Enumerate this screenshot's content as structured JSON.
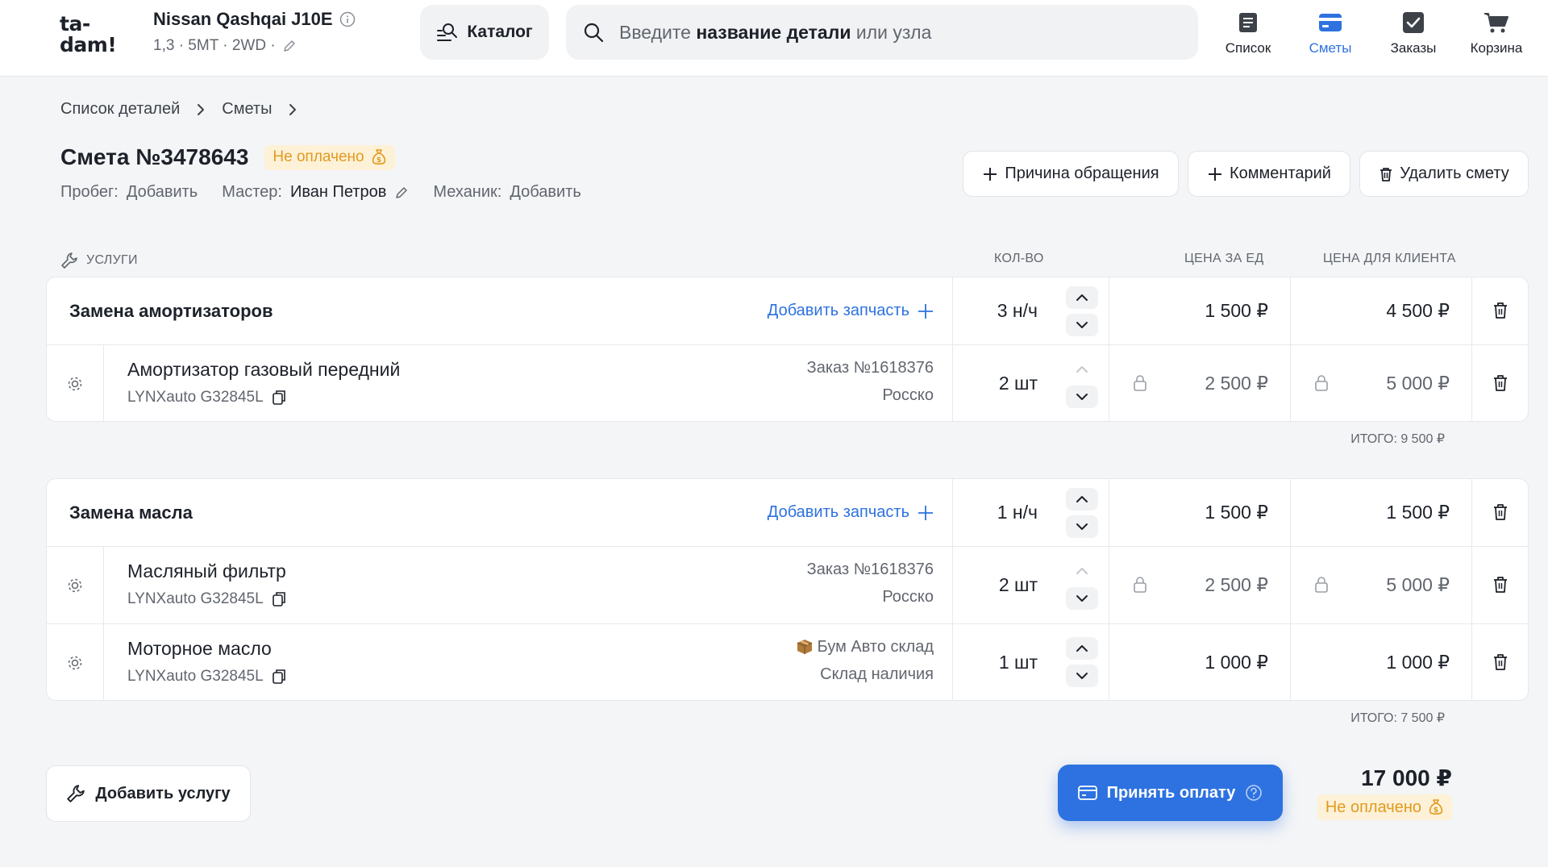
{
  "logo": {
    "line1": "ta-",
    "line2": "dam!"
  },
  "car": {
    "title": "Nissan Qashqai J10E",
    "subtitle": "1,3 · 5MT · 2WD ·"
  },
  "catalog": {
    "label": "Каталог"
  },
  "search": {
    "placeholder_pre": "Введите ",
    "placeholder_bold": "название детали",
    "placeholder_post": " или узла"
  },
  "nav": [
    {
      "label": "Список",
      "icon": "list-icon",
      "active": false
    },
    {
      "label": "Сметы",
      "icon": "estimates-icon",
      "active": true
    },
    {
      "label": "Заказы",
      "icon": "orders-icon",
      "active": false
    },
    {
      "label": "Корзина",
      "icon": "cart-icon",
      "active": false
    }
  ],
  "breadcrumb": [
    "Список деталей",
    "Сметы"
  ],
  "estimate": {
    "title": "Смета №3478643",
    "status": "Не оплачено",
    "mileage_label": "Пробег:",
    "mileage_value": "Добавить",
    "master_label": "Мастер:",
    "master_value": "Иван Петров",
    "mechanic_label": "Механик:",
    "mechanic_value": "Добавить"
  },
  "actions": {
    "reason": "Причина обращения",
    "comment": "Комментарий",
    "delete": "Удалить смету"
  },
  "table_header": {
    "services": "УСЛУГИ",
    "qty": "КОЛ-ВО",
    "unit_price": "ЦЕНА ЗА ЕД",
    "client_price": "ЦЕНА ДЛЯ КЛИЕНТА"
  },
  "services": [
    {
      "name": "Замена амортизаторов",
      "add_part": "Добавить запчасть",
      "qty": "3 н/ч",
      "unit_price": "1 500 ₽",
      "client_price": "4 500 ₽",
      "parts": [
        {
          "name": "Амортизатор газовый передний",
          "sku": "LYNXauto G32845L",
          "supplier_line1": "Заказ №1618376",
          "supplier_line2": "Росско",
          "qty": "2 шт",
          "unit_price": "2 500 ₽",
          "client_price": "5 000 ₽",
          "locked": true
        }
      ],
      "total": "ИТОГО: 9 500 ₽"
    },
    {
      "name": "Замена масла",
      "add_part": "Добавить запчасть",
      "qty": "1 н/ч",
      "unit_price": "1 500 ₽",
      "client_price": "1 500 ₽",
      "parts": [
        {
          "name": "Масляный фильтр",
          "sku": "LYNXauto G32845L",
          "supplier_line1": "Заказ №1618376",
          "supplier_line2": "Росско",
          "qty": "2 шт",
          "unit_price": "2 500 ₽",
          "client_price": "5 000 ₽",
          "locked": true
        },
        {
          "name": "Моторное масло",
          "sku": "LYNXauto G32845L",
          "supplier_line1": "Бум Авто склад",
          "supplier_line2": "Склад наличия",
          "qty": "1 шт",
          "unit_price": "1 000 ₽",
          "client_price": "1 000 ₽",
          "locked": false
        }
      ],
      "total": "ИТОГО: 7 500 ₽"
    }
  ],
  "footer": {
    "add_service": "Добавить услугу",
    "accept_payment": "Принять оплату",
    "grand_total": "17 000 ₽",
    "status": "Не оплачено"
  },
  "colors": {
    "accent": "#2d72e0",
    "warning_bg": "#fdf1d7",
    "warning_text": "#e19a1f"
  }
}
